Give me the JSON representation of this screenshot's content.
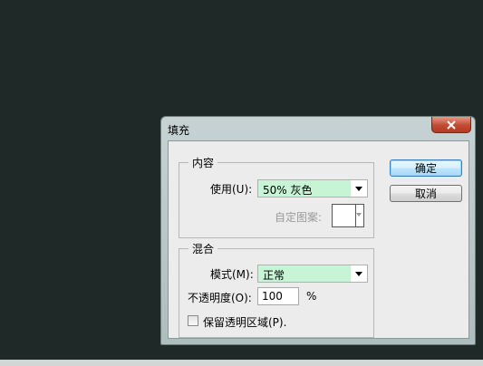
{
  "dialog": {
    "title": "填充",
    "close_icon": "close-icon"
  },
  "content_group": {
    "title": "内容",
    "use_label": "使用(U):",
    "use_value": "50% 灰色",
    "custom_pattern_label": "自定图案:"
  },
  "blend_group": {
    "title": "混合",
    "mode_label": "模式(M):",
    "mode_value": "正常",
    "opacity_label": "不透明度(O):",
    "opacity_value": "100",
    "opacity_unit": "%",
    "preserve_label": "保留透明区域(P)."
  },
  "buttons": {
    "ok": "确定",
    "cancel": "取消"
  },
  "colors": {
    "combo_bg": "#c7f4d5",
    "close_red": "#c14b33",
    "default_button_border": "#3c7fb1"
  }
}
